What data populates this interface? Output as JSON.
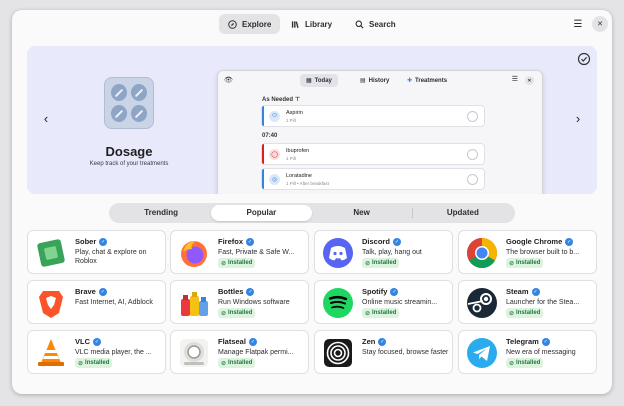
{
  "header": {
    "tabs": [
      {
        "label": "Explore",
        "icon": "compass-icon",
        "active": true
      },
      {
        "label": "Library",
        "icon": "library-icon",
        "active": false
      },
      {
        "label": "Search",
        "icon": "search-icon",
        "active": false
      }
    ]
  },
  "banner": {
    "title": "Dosage",
    "subtitle": "Keep track of your treatments",
    "preview": {
      "tabs": [
        {
          "label": "Today",
          "active": true
        },
        {
          "label": "History",
          "active": false
        },
        {
          "label": "Treatments",
          "active": false
        }
      ],
      "section_as_needed": "As Needed",
      "section_time": "07:40",
      "items": [
        {
          "name": "Aspirin",
          "detail": "1 Pill",
          "color": "#3584e4"
        },
        {
          "name": "Ibuprofen",
          "detail": "1 Pill",
          "color": "#e01b24"
        },
        {
          "name": "Loratadine",
          "detail": "1 Pill • After breakfast",
          "color": "#3584e4"
        }
      ]
    }
  },
  "category_tabs": [
    {
      "label": "Trending",
      "active": false
    },
    {
      "label": "Popular",
      "active": true
    },
    {
      "label": "New",
      "active": false
    },
    {
      "label": "Updated",
      "active": false
    }
  ],
  "installed_label": "Installed",
  "apps": [
    {
      "name": "Sober",
      "desc": "Play, chat & explore on Roblox",
      "installed": false,
      "icon": "sober-icon"
    },
    {
      "name": "Firefox",
      "desc": "Fast, Private & Safe W...",
      "installed": true,
      "icon": "firefox-icon"
    },
    {
      "name": "Discord",
      "desc": "Talk, play, hang out",
      "installed": true,
      "icon": "discord-icon"
    },
    {
      "name": "Google Chrome",
      "desc": "The browser built to b...",
      "installed": true,
      "icon": "chrome-icon"
    },
    {
      "name": "Brave",
      "desc": "Fast Internet, AI, Adblock",
      "installed": false,
      "icon": "brave-icon"
    },
    {
      "name": "Bottles",
      "desc": "Run Windows software",
      "installed": true,
      "icon": "bottles-icon"
    },
    {
      "name": "Spotify",
      "desc": "Online music streamin...",
      "installed": true,
      "icon": "spotify-icon"
    },
    {
      "name": "Steam",
      "desc": "Launcher for the Stea...",
      "installed": true,
      "icon": "steam-icon"
    },
    {
      "name": "VLC",
      "desc": "VLC media player, the ...",
      "installed": true,
      "icon": "vlc-icon"
    },
    {
      "name": "Flatseal",
      "desc": "Manage Flatpak permi...",
      "installed": true,
      "icon": "flatseal-icon"
    },
    {
      "name": "Zen",
      "desc": "Stay focused, browse faster",
      "installed": false,
      "icon": "zen-icon"
    },
    {
      "name": "Telegram",
      "desc": "New era of messaging",
      "installed": true,
      "icon": "telegram-icon"
    }
  ],
  "colors": {
    "accent": "#3584e4",
    "installed_bg": "#def2e0",
    "installed_fg": "#1c7a3b",
    "banner_bg": "#e8eafc"
  }
}
